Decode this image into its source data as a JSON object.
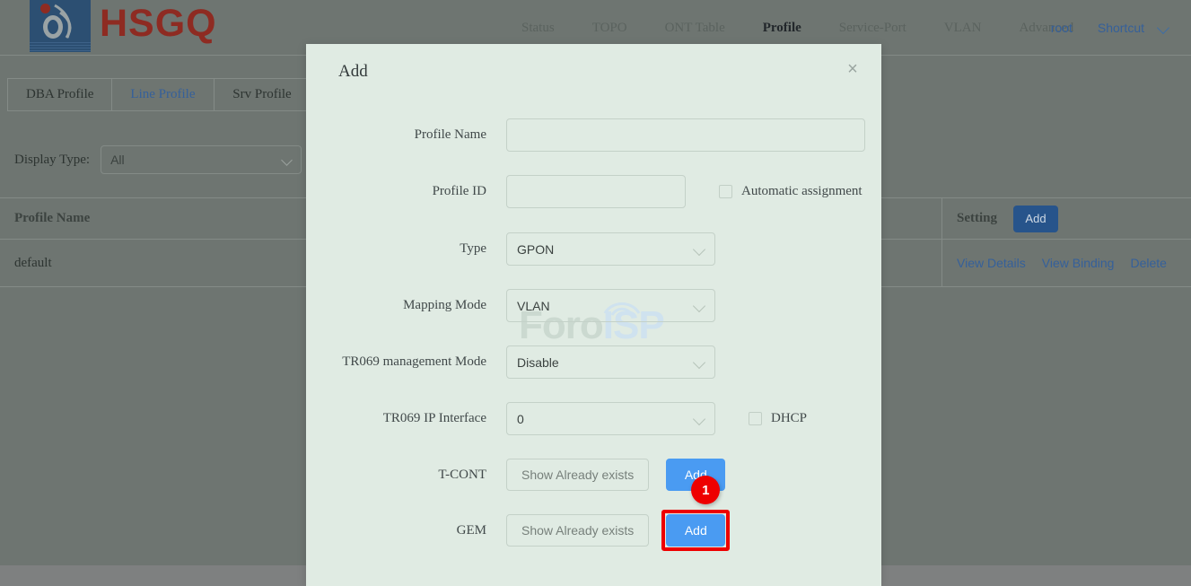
{
  "brand": {
    "logo_text": "HSGQ",
    "logo_icon": "hsgq-swirl-logo"
  },
  "nav": {
    "items": [
      {
        "label": "Status",
        "active": false
      },
      {
        "label": "TOPO",
        "active": false
      },
      {
        "label": "ONT Table",
        "active": false
      },
      {
        "label": "Profile",
        "active": true
      },
      {
        "label": "Service-Port",
        "active": false
      },
      {
        "label": "VLAN",
        "active": false
      },
      {
        "label": "Advanced",
        "active": false
      }
    ],
    "user": "root",
    "shortcut": "Shortcut"
  },
  "tabs": [
    {
      "label": "DBA Profile",
      "active": false
    },
    {
      "label": "Line Profile",
      "active": true
    },
    {
      "label": "Srv Profile",
      "active": false
    },
    {
      "label": "",
      "active": false
    }
  ],
  "filter": {
    "label": "Display Type:",
    "value": "All"
  },
  "table": {
    "headers": {
      "profile_name": "Profile Name",
      "setting": "Setting"
    },
    "header_add_button": "Add",
    "rows": [
      {
        "profile_name": "default",
        "actions": [
          "View Details",
          "View Binding",
          "Delete"
        ]
      }
    ]
  },
  "modal": {
    "title": "Add",
    "close_icon": "×",
    "fields": {
      "profile_name_label": "Profile Name",
      "profile_name_value": "",
      "profile_name_placeholder": "",
      "profile_id_label": "Profile ID",
      "profile_id_value": "",
      "profile_id_placeholder": "",
      "automatic_assignment_label": "Automatic assignment",
      "type_label": "Type",
      "type_value": "GPON",
      "mapping_mode_label": "Mapping Mode",
      "mapping_mode_value": "VLAN",
      "tr069_mode_label": "TR069 management Mode",
      "tr069_mode_value": "Disable",
      "tr069_ip_label": "TR069 IP Interface",
      "tr069_ip_value": "0",
      "dhcp_label": "DHCP",
      "tcont_label": "T-CONT",
      "tcont_show_button": "Show Already exists",
      "tcont_add_button": "Add",
      "gem_label": "GEM",
      "gem_show_button": "Show Already exists",
      "gem_add_button": "Add"
    }
  },
  "annotation": {
    "step_badge": "1"
  },
  "watermark": {
    "part1": "Foro",
    "part2": "ISP"
  },
  "colors": {
    "brand_red": "#8e2b22",
    "brand_blue": "#2c4f72",
    "link_blue": "#35609a",
    "accent_blue": "#4a9bf2",
    "highlight_red": "#ee0000",
    "modal_bg": "#e0ebe3"
  }
}
